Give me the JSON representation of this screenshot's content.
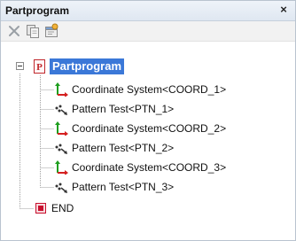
{
  "window": {
    "title": "Partprogram",
    "close_glyph": "×"
  },
  "toolbar": {
    "buttons": [
      {
        "name": "delete-icon"
      },
      {
        "name": "copy-icon"
      },
      {
        "name": "properties-icon"
      }
    ]
  },
  "tree": {
    "root": {
      "label": "Partprogram",
      "icon": "partprogram-icon",
      "expanded": true
    },
    "children": [
      {
        "label": "Coordinate System<COORD_1>",
        "icon": "coordinate-system-icon"
      },
      {
        "label": "Pattern Test<PTN_1>",
        "icon": "pattern-test-icon"
      },
      {
        "label": "Coordinate System<COORD_2>",
        "icon": "coordinate-system-icon"
      },
      {
        "label": "Pattern Test<PTN_2>",
        "icon": "pattern-test-icon"
      },
      {
        "label": "Coordinate System<COORD_3>",
        "icon": "coordinate-system-icon"
      },
      {
        "label": "Pattern Test<PTN_3>",
        "icon": "pattern-test-icon"
      }
    ],
    "end": {
      "label": "END",
      "icon": "end-icon"
    }
  },
  "colors": {
    "selection": "#3b78d8",
    "axis_red": "#d42020",
    "axis_green": "#1e9e1e",
    "end_red": "#c8102e"
  }
}
